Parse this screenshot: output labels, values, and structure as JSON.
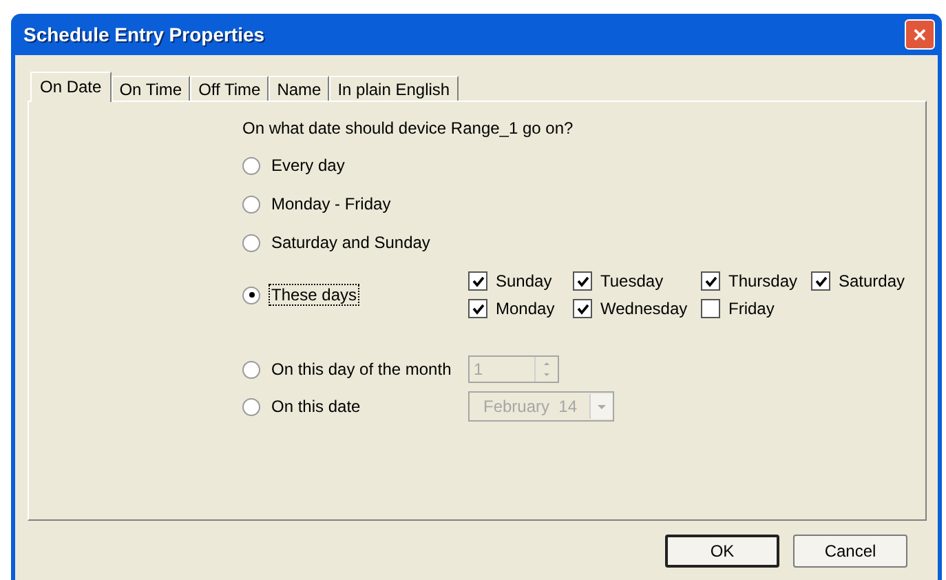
{
  "window": {
    "title": "Schedule Entry Properties",
    "close": "✕"
  },
  "tabs": [
    {
      "label": "On Date",
      "selected": true
    },
    {
      "label": "On Time",
      "selected": false
    },
    {
      "label": "Off Time",
      "selected": false
    },
    {
      "label": "Name",
      "selected": false
    },
    {
      "label": "In plain English",
      "selected": false
    }
  ],
  "question": "On what date should device Range_1 go on?",
  "options": [
    {
      "kind": "plain",
      "label": "Every day",
      "selected": false
    },
    {
      "kind": "plain",
      "label": "Monday - Friday",
      "selected": false
    },
    {
      "kind": "plain",
      "label": "Saturday and Sunday",
      "selected": false
    },
    {
      "kind": "days",
      "label": "These days",
      "selected": true,
      "focused": true,
      "days": [
        {
          "label": "Sunday",
          "checked": true
        },
        {
          "label": "Monday",
          "checked": true
        },
        {
          "label": "Tuesday",
          "checked": true
        },
        {
          "label": "Wednesday",
          "checked": true
        },
        {
          "label": "Thursday",
          "checked": true
        },
        {
          "label": "Friday",
          "checked": false
        },
        {
          "label": "Saturday",
          "checked": true
        }
      ]
    },
    {
      "kind": "spin",
      "label": "On this day of the month",
      "selected": false,
      "value": "1",
      "disabled": true
    },
    {
      "kind": "date",
      "label": "On this date",
      "selected": false,
      "month": "February",
      "day": "14",
      "disabled": true
    }
  ],
  "buttons": [
    {
      "label": "OK",
      "default": true
    },
    {
      "label": "Cancel",
      "default": false
    }
  ]
}
